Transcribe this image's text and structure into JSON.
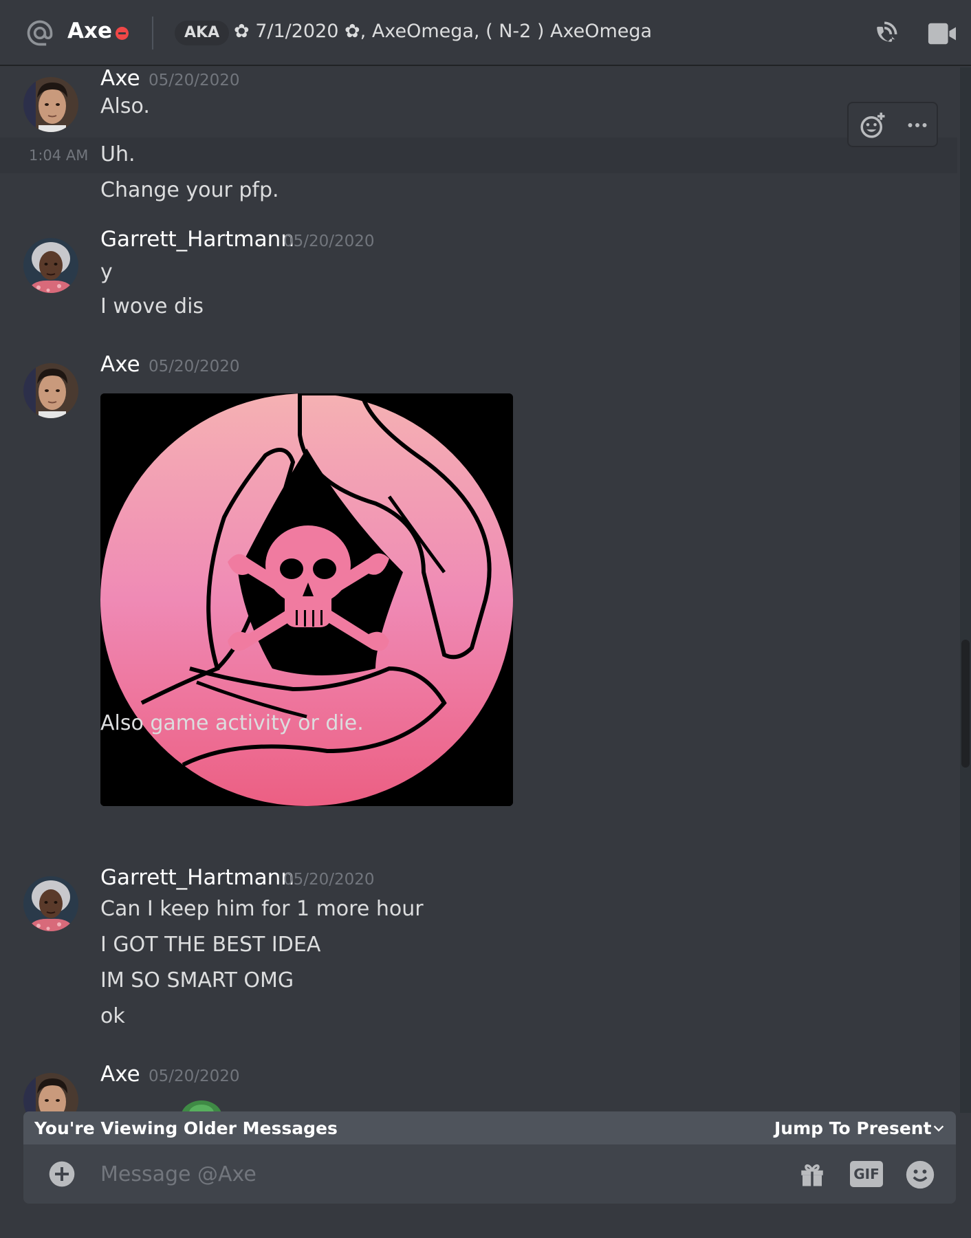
{
  "header": {
    "name": "Axe",
    "aka_label": "AKA",
    "nicknames": "✿ 7/1/2020 ✿, AxeOmega, ( N-2 ) AxeOmega"
  },
  "hover": {
    "timestamp": "1:04 AM"
  },
  "messages": [
    {
      "author": "Axe",
      "date": "05/20/2020",
      "lines": [
        "Also.",
        "Uh.",
        "Change your pfp."
      ]
    },
    {
      "author": "Garrett_Hartmann",
      "date": "05/20/2020",
      "lines": [
        "y",
        "I wove dis"
      ]
    },
    {
      "author": "Axe",
      "date": "05/20/2020",
      "lines": [
        "Also game activity or die."
      ]
    },
    {
      "author": "Garrett_Hartmann",
      "date": "05/20/2020",
      "lines": [
        "Can I keep him for 1 more hour",
        "I GOT THE BEST IDEA",
        "IM SO SMART OMG",
        "ok"
      ]
    },
    {
      "author": "Axe",
      "date": "05/20/2020",
      "lines": []
    }
  ],
  "older_bar": {
    "label": "You're Viewing Older Messages",
    "jump": "Jump To Present"
  },
  "composer": {
    "placeholder": "Message @Axe",
    "gif_label": "GIF"
  },
  "colors": {
    "background": "#36393f",
    "dnd_status": "#f04747",
    "attachment_pink": "#f07ba0"
  },
  "icons": [
    "mention-icon",
    "dnd-status-icon",
    "voice-call-icon",
    "video-call-icon",
    "add-reaction-icon",
    "more-icon",
    "chevron-down-icon",
    "add-attachment-icon",
    "gift-icon",
    "gif-icon",
    "emoji-icon"
  ]
}
